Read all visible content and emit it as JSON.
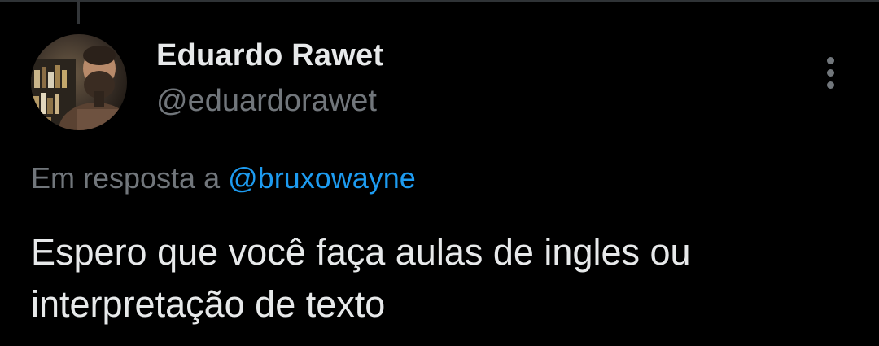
{
  "tweet": {
    "author": {
      "display_name": "Eduardo Rawet",
      "handle": "@eduardorawet"
    },
    "reply_to": {
      "prefix": "Em resposta a",
      "mention": "@bruxowayne"
    },
    "text_lines": [
      "Espero que você faça aulas de ingles ou",
      "interpretação de texto"
    ],
    "more_icon": "more-vertical-icon"
  },
  "colors": {
    "background": "#000000",
    "primary_text": "#e7e9ea",
    "secondary_text": "#71767b",
    "link": "#1d9bf0",
    "divider": "#2f3336"
  }
}
